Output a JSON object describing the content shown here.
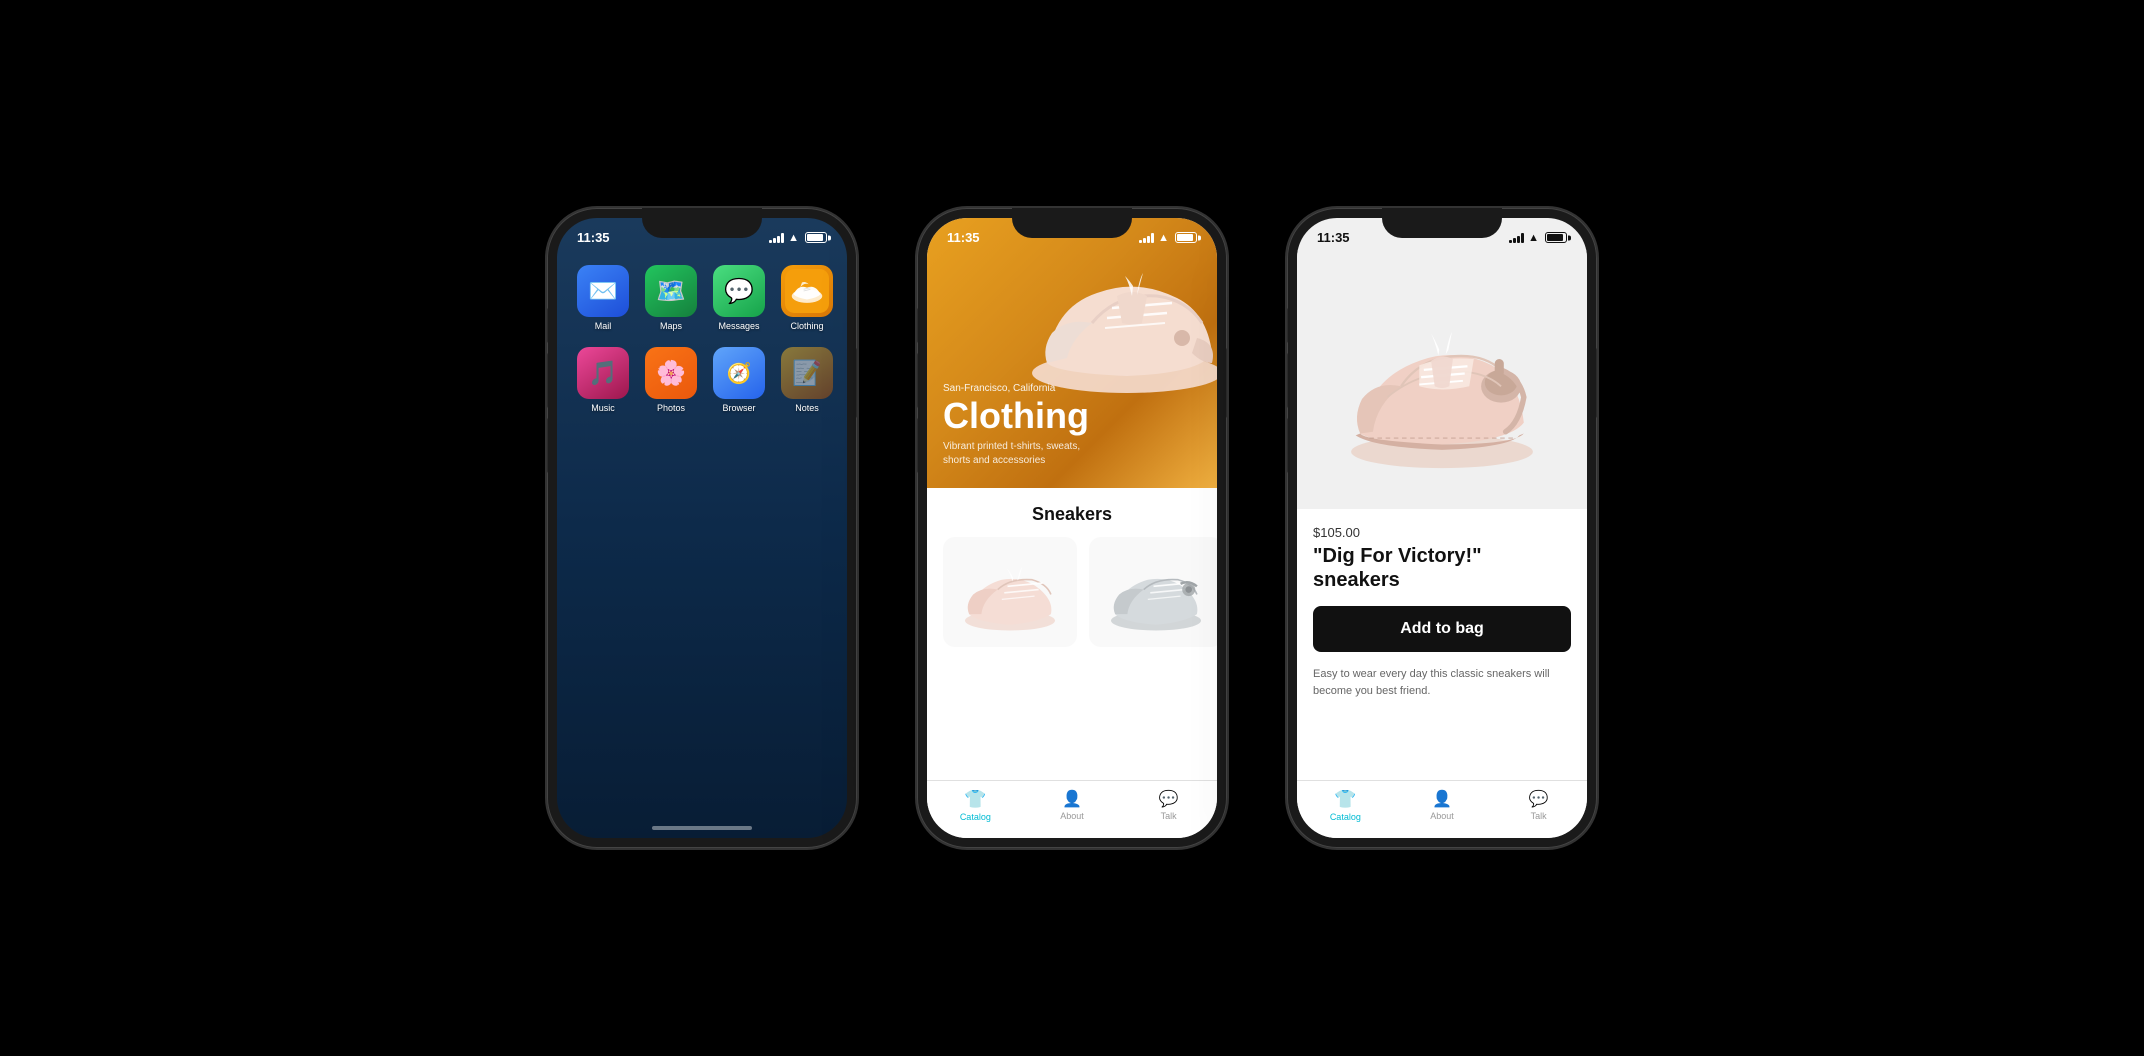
{
  "colors": {
    "background": "#000000",
    "phone1_bg": "#1a3a5c",
    "phone2_hero": "#e8a020",
    "accent": "#00bcd4",
    "dark": "#111111"
  },
  "phone1": {
    "status_time": "11:35",
    "apps_row1": [
      {
        "name": "Mail",
        "icon_type": "mail",
        "label": "Mail"
      },
      {
        "name": "Maps",
        "icon_type": "maps",
        "label": "Maps"
      },
      {
        "name": "Messages",
        "icon_type": "messages",
        "label": "Messages"
      },
      {
        "name": "Clothing",
        "icon_type": "clothing",
        "label": "Clothing"
      }
    ],
    "apps_row2": [
      {
        "name": "Music",
        "icon_type": "music",
        "label": "Music"
      },
      {
        "name": "Photos",
        "icon_type": "photos",
        "label": "Photos"
      },
      {
        "name": "Browser",
        "icon_type": "browser",
        "label": "Browser"
      },
      {
        "name": "Notes",
        "icon_type": "notes",
        "label": "Notes"
      }
    ]
  },
  "phone2": {
    "status_time": "11:35",
    "hero": {
      "location": "San-Francisco, California",
      "title": "Clothing",
      "subtitle": "Vibrant printed t-shirts, sweats, shorts and accessories"
    },
    "section_title": "Sneakers",
    "tabs": [
      {
        "label": "Catalog",
        "active": true
      },
      {
        "label": "About",
        "active": false
      },
      {
        "label": "Talk",
        "active": false
      }
    ]
  },
  "phone3": {
    "status_time": "11:35",
    "product": {
      "price": "$105.00",
      "name": "\"Dig For Victory!\" sneakers",
      "add_to_bag": "Add to bag",
      "description": "Easy to wear every day this classic sneakers will become you best friend."
    },
    "tabs": [
      {
        "label": "Catalog",
        "active": true
      },
      {
        "label": "About",
        "active": false
      },
      {
        "label": "Talk",
        "active": false
      }
    ]
  }
}
